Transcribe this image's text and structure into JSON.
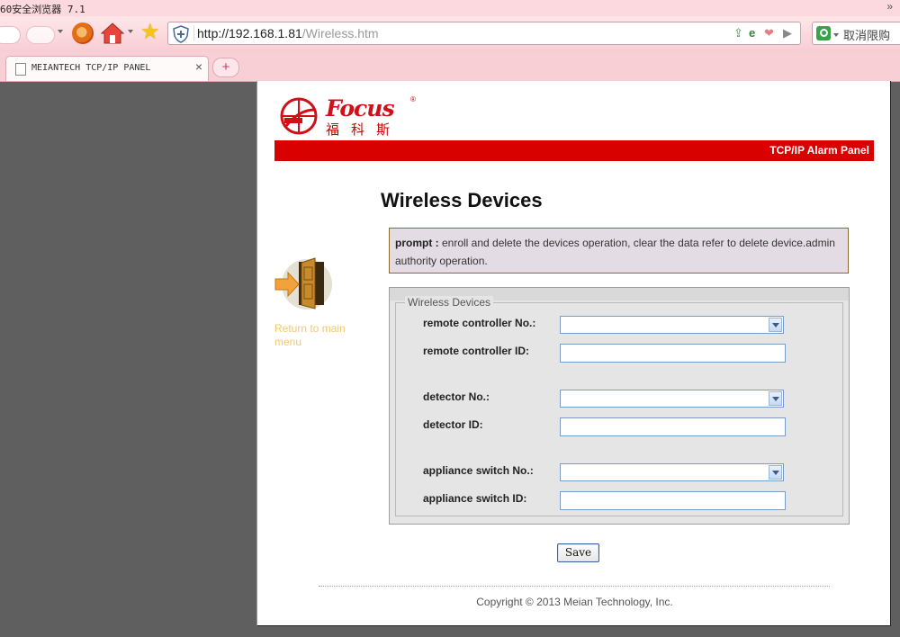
{
  "browser": {
    "window_title": "60安全浏览器 7.1",
    "more": "»",
    "url_host": "http://192.168.1.81",
    "url_path": "/Wireless.htm",
    "search_text": "取消限购",
    "tab_title": "MEIANTECH TCP/IP PANEL",
    "tab_close": "×",
    "new_tab": "+"
  },
  "header": {
    "brand_word": "Focus",
    "brand_registered": "®",
    "brand_cn": "福科斯",
    "banner_text": "TCP/IP Alarm Panel"
  },
  "page": {
    "title": "Wireless Devices",
    "prompt_label": "prompt :",
    "prompt_text": " enroll and delete the devices operation, clear the data refer to delete device.admin authority operation.",
    "return_link": "Return to main menu"
  },
  "form": {
    "legend": "Wireless Devices",
    "remote_no_label": "remote controller No.:",
    "remote_id_label": "remote controller ID:",
    "detector_no_label": "detector No.:",
    "detector_id_label": "detector ID:",
    "appliance_no_label": "appliance switch No.:",
    "appliance_id_label": "appliance switch ID:",
    "remote_no_value": "",
    "remote_id_value": "",
    "detector_no_value": "",
    "detector_id_value": "",
    "appliance_no_value": "",
    "appliance_id_value": "",
    "save_label": "Save"
  },
  "footer": {
    "copyright": "Copyright © 2013 Meian Technology, Inc."
  },
  "colors": {
    "banner_red": "#d90000",
    "prompt_bg": "#e4dce4",
    "return_link": "#f3c86b",
    "chrome_pink": "#f8cdd4"
  },
  "icons": [
    "cloud-icon",
    "chevron-down-icon",
    "360-logo-icon",
    "home-icon",
    "star-icon",
    "shield-icon",
    "share-icon",
    "ie-icon",
    "heart-icon",
    "play-icon",
    "search-icon",
    "page-icon",
    "close-icon",
    "plus-icon",
    "door-icon",
    "arrow-right-icon"
  ]
}
